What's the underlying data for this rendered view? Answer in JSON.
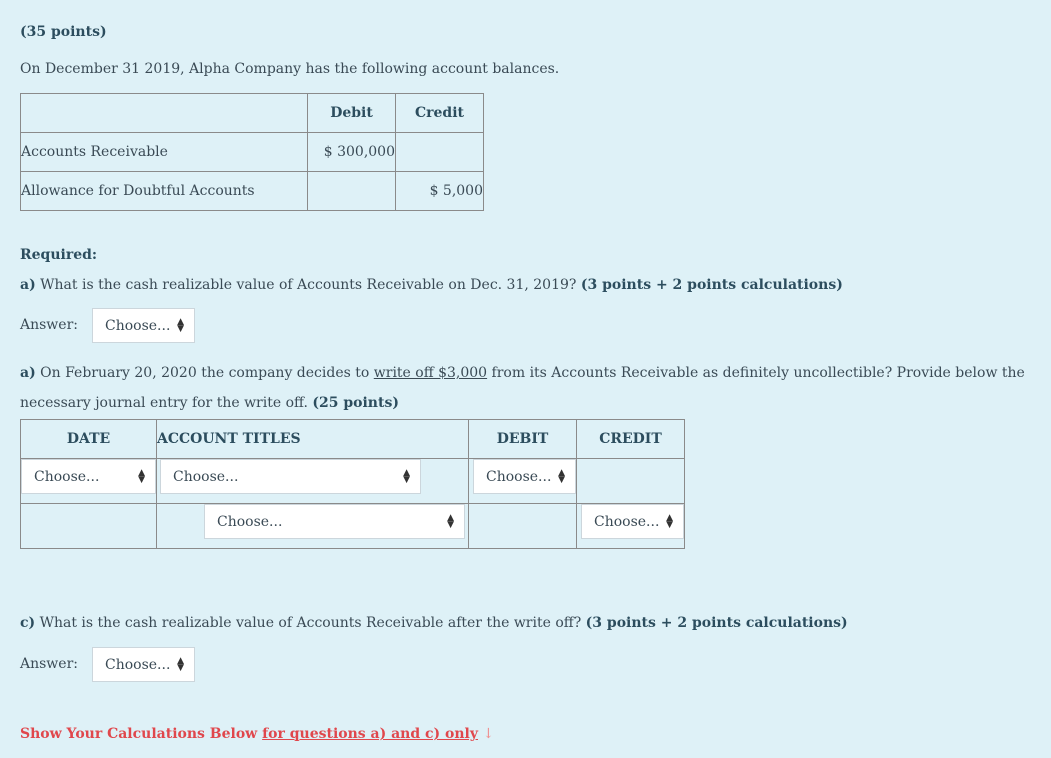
{
  "title": "(35 points)",
  "intro": "On December 31 2019, Alpha Company has the following account balances.",
  "balances": {
    "headers": [
      "",
      "Debit",
      "Credit"
    ],
    "rows": [
      {
        "account": "Accounts Receivable",
        "debit": "$ 300,000",
        "credit": ""
      },
      {
        "account": "Allowance for Doubtful Accounts",
        "debit": "",
        "credit": "$ 5,000"
      }
    ]
  },
  "required_label": "Required:",
  "question_a": {
    "prefix": "a)",
    "text": " What is the cash realizable value of Accounts Receivable on Dec. 31, 2019? ",
    "points": "(3 points + 2 points calculations)"
  },
  "answer_label": "Answer:",
  "select_placeholder": "Choose...",
  "question_b": {
    "prefix": "a)",
    "text_1": " On February 20, 2020 the company decides to ",
    "underlined": "write off $3,000",
    "text_2": " from its Accounts Receivable as definitely uncollectible? Provide below the necessary journal entry for the write off. ",
    "points": "(25 points)"
  },
  "journal": {
    "headers": [
      "DATE",
      "ACCOUNT TITLES",
      "DEBIT",
      "CREDIT"
    ],
    "row1": {
      "date": "Choose...",
      "account": "Choose...",
      "debit": "Choose..."
    },
    "row2": {
      "account": "Choose...",
      "credit": "Choose..."
    }
  },
  "question_c": {
    "prefix": "c)",
    "text": " What is the cash realizable value of Accounts Receivable after the write off? ",
    "points": "(3 points + 2 points calculations)"
  },
  "calc_note": {
    "bold": "Show Your Calculations Below ",
    "underlined": "for questions a) and c) only",
    "arrow": " ↓"
  },
  "colors": {
    "background": "#def1f7",
    "heading": "#2c4d5e",
    "alert": "#e0474c"
  }
}
